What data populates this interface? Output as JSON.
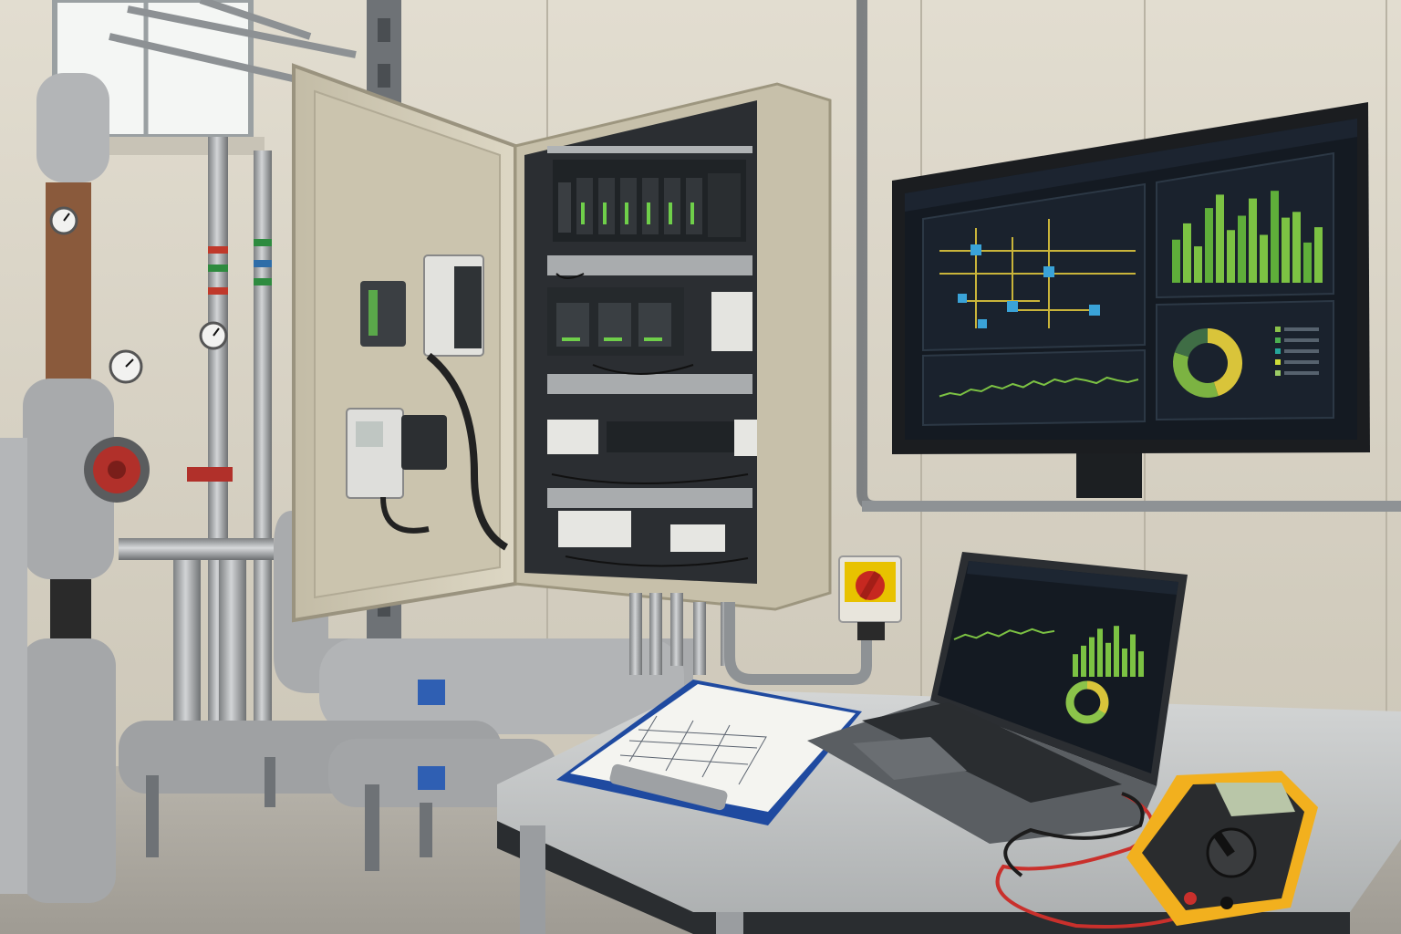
{
  "scene": {
    "description_title": "",
    "wall_monitor": {
      "header": "",
      "panels": {
        "schematic_label": "",
        "trend_label": "",
        "bars_label": "",
        "donut_label": ""
      },
      "bar_values": [
        0.45,
        0.62,
        0.38,
        0.78,
        0.92,
        0.55,
        0.7,
        0.88,
        0.5,
        0.96,
        0.68,
        0.74,
        0.42,
        0.58
      ],
      "trend_values": [
        0.35,
        0.42,
        0.38,
        0.5,
        0.46,
        0.58,
        0.52,
        0.62,
        0.55,
        0.68,
        0.6,
        0.72,
        0.66,
        0.74,
        0.7,
        0.64,
        0.76,
        0.7,
        0.66,
        0.72
      ],
      "donut_segments": [
        {
          "name": "",
          "fraction": 0.45,
          "color": "#d9c43a"
        },
        {
          "name": "",
          "fraction": 0.35,
          "color": "#7cb342"
        },
        {
          "name": "",
          "fraction": 0.2,
          "color": "#3f6d45"
        }
      ],
      "legend_colors": [
        "#8bc34a",
        "#4caf50",
        "#26a69a",
        "#cddc39",
        "#9ccc65"
      ]
    },
    "laptop": {
      "bar_values": [
        0.4,
        0.55,
        0.7,
        0.85,
        0.6,
        0.9,
        0.5,
        0.75,
        0.45
      ],
      "trend_values": [
        0.4,
        0.55,
        0.45,
        0.62,
        0.5,
        0.68,
        0.58,
        0.72,
        0.6,
        0.66
      ]
    },
    "multimeter": {
      "body_color": "#f2b01e",
      "display_color": "#b9c6a8"
    },
    "colors": {
      "wall": "#d8d3c4",
      "cabinet": "#cfc8b3",
      "cabinet_interior": "#2c2f33",
      "pipe_insulation": "#a7a9ab",
      "screen_bg": "#141a22",
      "accent_green": "#7cc243",
      "accent_yellow": "#e8c534",
      "table": "#c9cccd",
      "clipboard": "#1f4aa0"
    }
  }
}
